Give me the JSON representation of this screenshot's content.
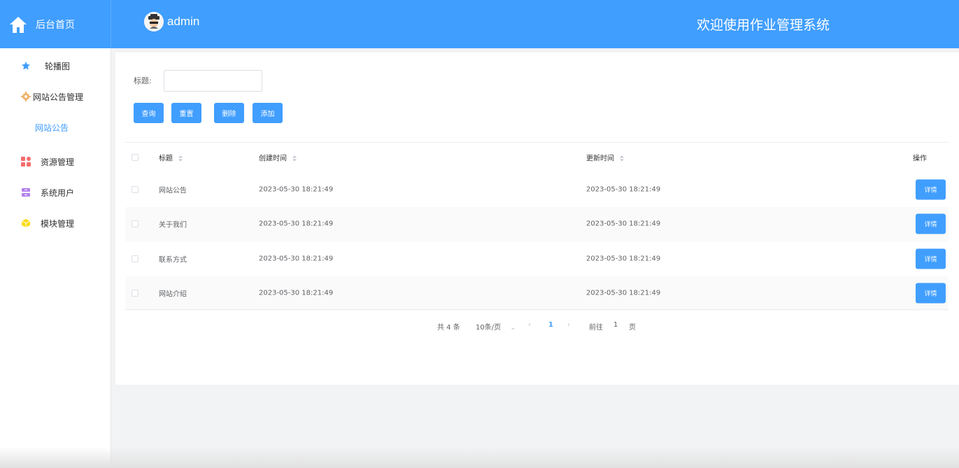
{
  "header": {
    "home_label": "后台首页",
    "username": "admin",
    "system_title": "欢迎使用作业管理系统"
  },
  "sidebar": {
    "items": [
      {
        "label": "轮播图",
        "icon": "star-icon",
        "color": "#409eff"
      },
      {
        "label": "网站公告管理",
        "icon": "gear-icon",
        "color": "#f0b26a"
      },
      {
        "label": "网站公告",
        "icon": "",
        "color": "#409eff"
      },
      {
        "label": "资源管理",
        "icon": "grid-icon",
        "color": "#f56c6c"
      },
      {
        "label": "系统用户",
        "icon": "archive-icon",
        "color": "#b37feb"
      },
      {
        "label": "模块管理",
        "icon": "cube-icon",
        "color": "#fadb14"
      }
    ]
  },
  "search": {
    "label": "标题:",
    "value": "",
    "placeholder": ""
  },
  "toolbar": {
    "query": "查询",
    "reset": "重置",
    "delete": "删除",
    "add": "添加"
  },
  "table": {
    "columns": [
      "标题",
      "创建时间",
      "更新时间",
      "操作"
    ],
    "rows": [
      {
        "title": "网站公告",
        "created": "2023-05-30 18:21:49",
        "updated": "2023-05-30 18:21:49",
        "action": "详情"
      },
      {
        "title": "关于我们",
        "created": "2023-05-30 18:21:49",
        "updated": "2023-05-30 18:21:49",
        "action": "详情"
      },
      {
        "title": "联系方式",
        "created": "2023-05-30 18:21:49",
        "updated": "2023-05-30 18:21:49",
        "action": "详情"
      },
      {
        "title": "网站介绍",
        "created": "2023-05-30 18:21:49",
        "updated": "2023-05-30 18:21:49",
        "action": "详情"
      }
    ]
  },
  "pagination": {
    "total": "共 4 条",
    "page_size": "10条/页",
    "current_page": "1",
    "goto_prefix": "前往",
    "goto_value": "1",
    "goto_suffix": "页"
  },
  "colors": {
    "primary": "#409eff",
    "header_bg": "#409eff"
  }
}
